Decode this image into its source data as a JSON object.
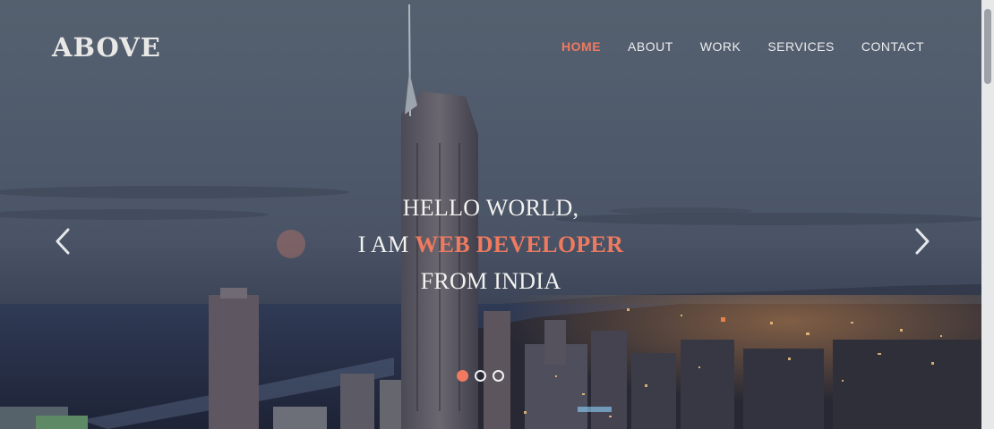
{
  "brand": {
    "logo_text": "ABOVE"
  },
  "nav": {
    "items": [
      "HOME",
      "ABOUT",
      "WORK",
      "SERVICES",
      "CONTACT"
    ],
    "active": "HOME"
  },
  "hero": {
    "line1": "HELLO WORLD,",
    "line2_prefix": "I AM ",
    "line2_highlight": "WEB DEVELOPER",
    "line3": "FROM INDIA"
  },
  "carousel": {
    "slide_count": 3,
    "active_slide": 1
  },
  "icons": {
    "prev": "chevron-left-icon",
    "next": "chevron-right-icon"
  },
  "colors": {
    "accent": "#f07a5f",
    "text": "#f2f2f0"
  }
}
